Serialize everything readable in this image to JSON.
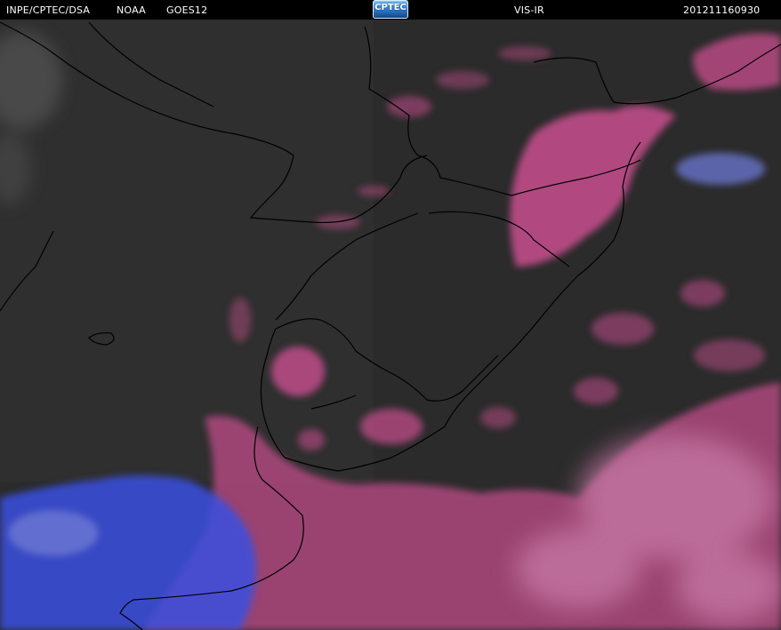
{
  "header": {
    "source": "INPE/CPTEC/DSA",
    "agency": "NOAA",
    "satellite": "GOES12",
    "logo_text": "CPTEC",
    "channel": "VIS-IR",
    "timestamp": "201211160930"
  },
  "colors": {
    "background": "#2b2b2b",
    "cloud_ir": "#c04d8a",
    "cloud_cold": "#3b4fe0",
    "border_lines": "#000000"
  }
}
